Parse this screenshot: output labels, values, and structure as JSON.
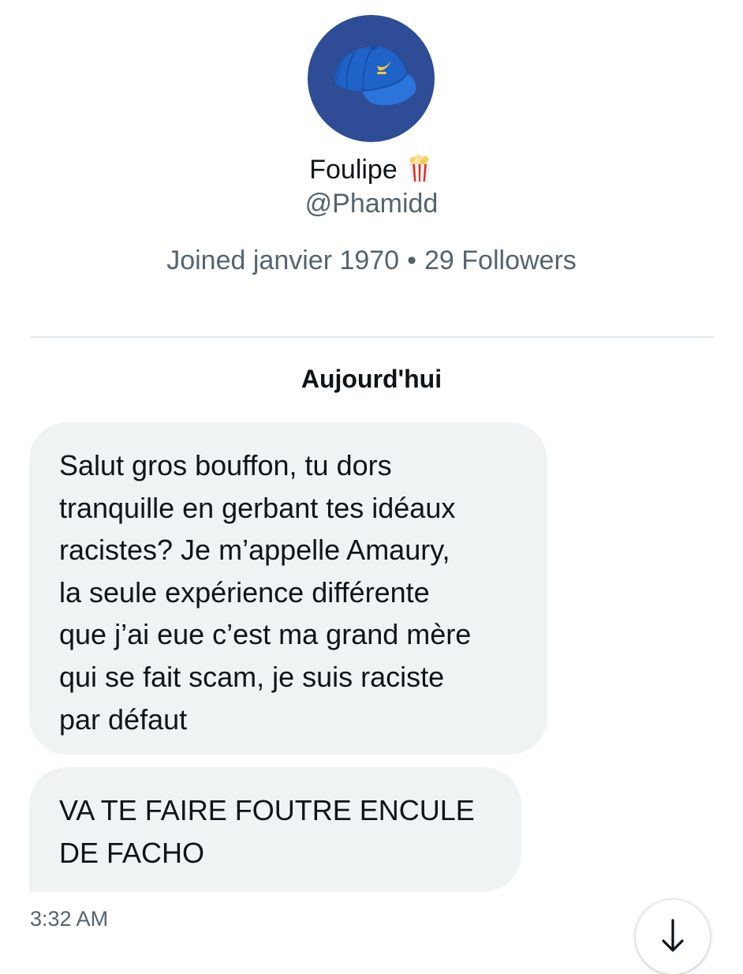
{
  "profile": {
    "avatar_icon": "blue-cap-icon",
    "display_name": "Foulipe",
    "name_emoji": "popcorn-icon",
    "handle": "@Phamidd",
    "joined": "Joined janvier 1970",
    "separator": "•",
    "followers": "29 Followers"
  },
  "conversation": {
    "date_header": "Aujourd'hui",
    "messages": [
      {
        "lines": [
          "Salut gros bouffon, tu dors",
          "tranquille en gerbant tes idéaux",
          "racistes? Je m’appelle Amaury,",
          "la seule expérience différente",
          "que j’ai eue c’est ma grand mère",
          "qui se fait scam, je suis raciste",
          "par défaut"
        ]
      },
      {
        "lines": [
          "VA TE FAIRE FOUTRE ENCULE",
          "DE FACHO"
        ]
      }
    ],
    "timestamp": "3:32 AM",
    "scroll_button_icon": "arrow-down-icon"
  },
  "colors": {
    "bubble_background": "#eff3f4",
    "secondary_text": "#536471",
    "avatar_background": "#2f4c96",
    "cap_blue": "#1f63c9"
  }
}
